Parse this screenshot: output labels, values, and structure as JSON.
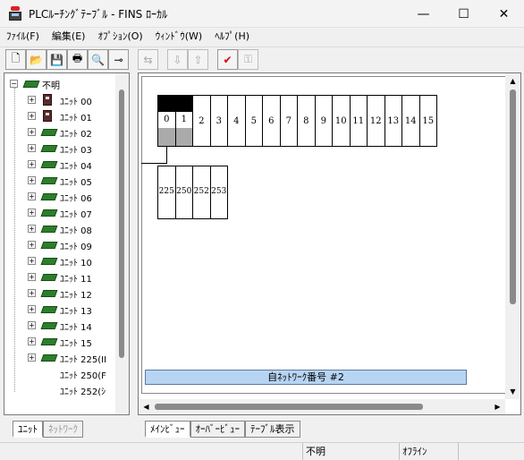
{
  "window": {
    "title": "PLCﾙｰﾁﾝｸﾞﾃｰﾌﾞﾙ - FINS ﾛｰｶﾙ",
    "minimize": "—",
    "maximize": "☐",
    "close": "✕"
  },
  "menu": [
    "ﾌｧｲﾙ(F)",
    "編集(E)",
    "ｵﾌﾟｼｮﾝ(O)",
    "ｳｨﾝﾄﾞｳ(W)",
    "ﾍﾙﾌﾟ(H)"
  ],
  "toolbar": {
    "new": "🗋",
    "open": "📂",
    "save": "💾",
    "print": "🖶",
    "preview": "🔍",
    "pin": "⊸",
    "t1": "⇆",
    "t2": "⇩",
    "t3": "⇧",
    "check": "✔",
    "key": "⚿"
  },
  "tree": {
    "root": "不明",
    "items": [
      {
        "label": "ﾕﾆｯﾄ 00",
        "icon": "plc"
      },
      {
        "label": "ﾕﾆｯﾄ 01",
        "icon": "plc"
      },
      {
        "label": "ﾕﾆｯﾄ 02",
        "icon": "board"
      },
      {
        "label": "ﾕﾆｯﾄ 03",
        "icon": "board"
      },
      {
        "label": "ﾕﾆｯﾄ 04",
        "icon": "board"
      },
      {
        "label": "ﾕﾆｯﾄ 05",
        "icon": "board"
      },
      {
        "label": "ﾕﾆｯﾄ 06",
        "icon": "board"
      },
      {
        "label": "ﾕﾆｯﾄ 07",
        "icon": "board"
      },
      {
        "label": "ﾕﾆｯﾄ 08",
        "icon": "board"
      },
      {
        "label": "ﾕﾆｯﾄ 09",
        "icon": "board"
      },
      {
        "label": "ﾕﾆｯﾄ 10",
        "icon": "board"
      },
      {
        "label": "ﾕﾆｯﾄ 11",
        "icon": "board"
      },
      {
        "label": "ﾕﾆｯﾄ 12",
        "icon": "board"
      },
      {
        "label": "ﾕﾆｯﾄ 13",
        "icon": "board"
      },
      {
        "label": "ﾕﾆｯﾄ 14",
        "icon": "board"
      },
      {
        "label": "ﾕﾆｯﾄ 15",
        "icon": "board"
      },
      {
        "label": "ﾕﾆｯﾄ 225(II",
        "icon": "board"
      },
      {
        "label": "ﾕﾆｯﾄ 250(F",
        "icon": "none"
      },
      {
        "label": "ﾕﾆｯﾄ 252(ｼ",
        "icon": "none"
      }
    ]
  },
  "left_tabs": [
    "ﾕﾆｯﾄ",
    "ﾈｯﾄﾜｰｸ"
  ],
  "rack_slots": [
    "0",
    "1",
    "2",
    "3",
    "4",
    "5",
    "6",
    "7",
    "8",
    "9",
    "10",
    "11",
    "12",
    "13",
    "14",
    "15"
  ],
  "sub_slots": [
    "225",
    "250",
    "252",
    "253"
  ],
  "network_bar": "自ﾈｯﾄﾜｰｸ番号 #2",
  "right_tabs": [
    "ﾒｲﾝﾋﾞｭｰ",
    "ｵｰﾊﾞｰﾋﾞｭｰ",
    "ﾃｰﾌﾞﾙ表示"
  ],
  "status": {
    "state": "不明",
    "mode": "ｵﾌﾗｲﾝ"
  }
}
